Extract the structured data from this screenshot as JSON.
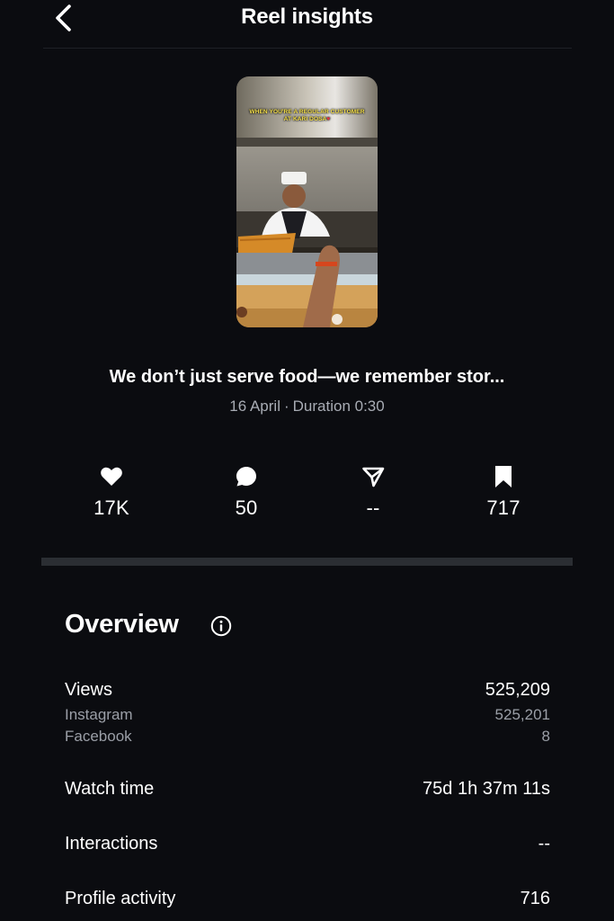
{
  "header": {
    "title": "Reel insights"
  },
  "reel": {
    "thumbnail_caption_line1": "WHEN YOU'RE A REGULAR CUSTOMER",
    "thumbnail_caption_line2": "AT KARI DOSA",
    "title": "We don’t just serve food—we remember stor...",
    "date": "16 April",
    "duration": "Duration 0:30"
  },
  "stats": {
    "likes": "17K",
    "comments": "50",
    "shares": "--",
    "saves": "717"
  },
  "overview": {
    "title": "Overview",
    "rows": [
      {
        "label": "Views",
        "value": "525,209"
      },
      {
        "label": "Instagram",
        "value": "525,201"
      },
      {
        "label": "Facebook",
        "value": "8"
      },
      {
        "label": "Watch time",
        "value": "75d 1h 37m 11s"
      },
      {
        "label": "Interactions",
        "value": "--"
      },
      {
        "label": "Profile activity",
        "value": "716"
      }
    ]
  },
  "icons": {
    "back": "chevron-left-icon",
    "like": "heart-icon",
    "comment": "comment-bubble-icon",
    "share": "paper-plane-icon",
    "save": "bookmark-icon",
    "info": "info-icon"
  },
  "colors": {
    "background": "#0b0c10",
    "divider": "#2b2e33",
    "secondary_text": "#9b9fa7"
  }
}
